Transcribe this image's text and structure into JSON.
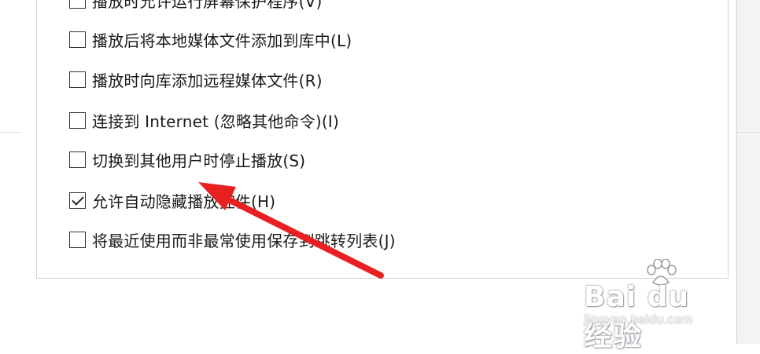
{
  "options": [
    {
      "label": "播放时允许运行屏幕保护程序(V)",
      "checked": false
    },
    {
      "label": "播放后将本地媒体文件添加到库中(L)",
      "checked": false
    },
    {
      "label": "播放时向库添加远程媒体文件(R)",
      "checked": false
    },
    {
      "label": "连接到 Internet (忽略其他命令)(I)",
      "checked": false
    },
    {
      "label": "切换到其他用户时停止播放(S)",
      "checked": false
    },
    {
      "label": "允许自动隐藏播放控件(H)",
      "checked": true
    },
    {
      "label": "将最近使用而非最常使用保存到跳转列表(J)",
      "checked": false
    }
  ],
  "annotation": {
    "arrow_color": "#e8201f"
  },
  "watermark": {
    "logo": "Bai du 经验",
    "url": "jingyan.baidu.com"
  }
}
